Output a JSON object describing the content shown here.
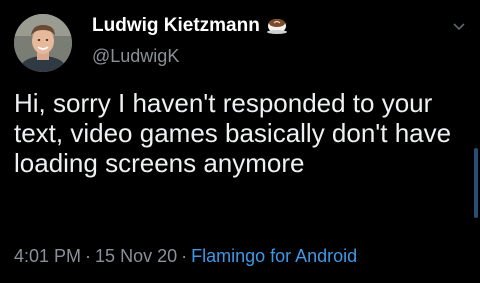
{
  "author": {
    "display_name": "Ludwig Kietzmann",
    "handle": "@LudwigK",
    "name_emoji": "coffee-cup-icon",
    "avatar_icon": "avatar-photo"
  },
  "tweet": {
    "text": "Hi, sorry I haven't responded to your text, video games basically don't have loading screens anymore"
  },
  "meta": {
    "time": "4:01 PM",
    "date": "15 Nov 20",
    "source": "Flamingo for Android",
    "separator": "·"
  },
  "menu": {
    "icon": "chevron-down-icon"
  },
  "colors": {
    "background": "#000000",
    "text": "#eef0f1",
    "secondary": "#8b9098",
    "link": "#3e98e8"
  }
}
